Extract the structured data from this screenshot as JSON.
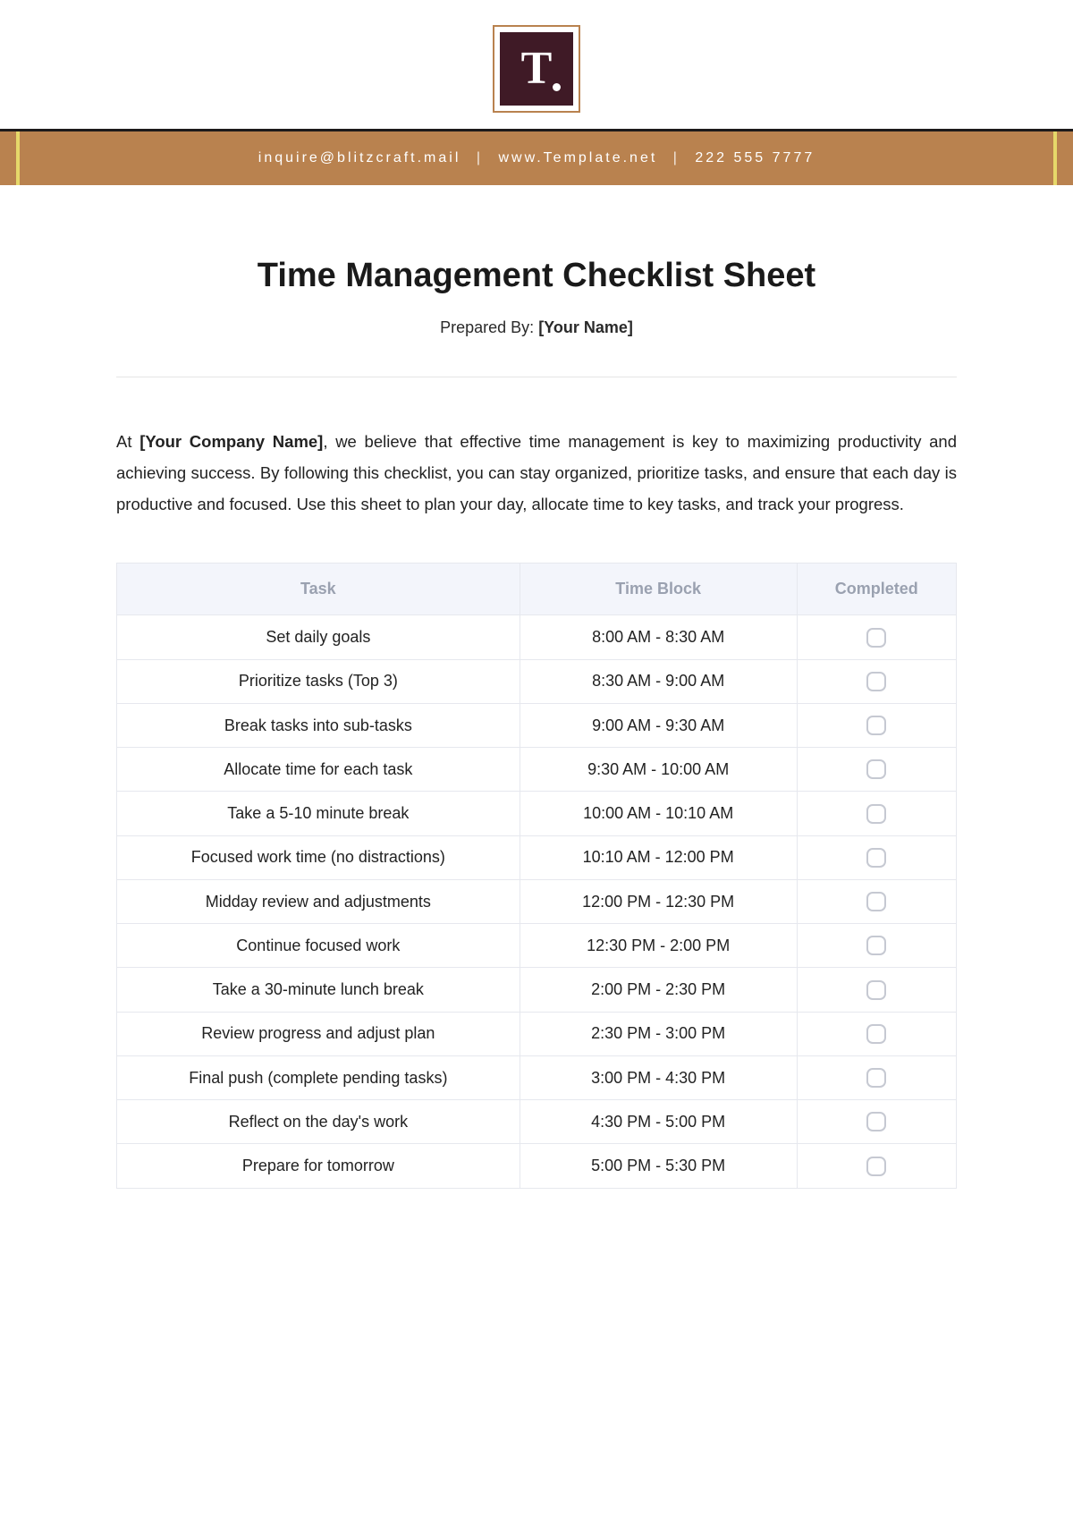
{
  "logo": {
    "letter": "T"
  },
  "banner": {
    "email": "inquire@blitzcraft.mail",
    "site": "www.Template.net",
    "phone": "222 555 7777"
  },
  "title": "Time Management Checklist Sheet",
  "prepared_by_label": "Prepared By: ",
  "prepared_by_value": "[Your Name]",
  "intro_prefix": "At ",
  "intro_company": "[Your Company Name]",
  "intro_rest": ", we believe that effective time management is key to maximizing productivity and achieving success. By following this checklist, you can stay organized, prioritize tasks, and ensure that each day is productive and focused. Use this sheet to plan your day, allocate time to key tasks, and track your progress.",
  "columns": {
    "task": "Task",
    "time": "Time Block",
    "done": "Completed"
  },
  "rows": [
    {
      "task": "Set daily goals",
      "time": "8:00 AM - 8:30 AM"
    },
    {
      "task": "Prioritize tasks (Top 3)",
      "time": "8:30 AM - 9:00 AM"
    },
    {
      "task": "Break tasks into sub-tasks",
      "time": "9:00 AM - 9:30 AM"
    },
    {
      "task": "Allocate time for each task",
      "time": "9:30 AM - 10:00 AM"
    },
    {
      "task": "Take a 5-10 minute break",
      "time": "10:00 AM - 10:10 AM"
    },
    {
      "task": "Focused work time (no distractions)",
      "time": "10:10 AM - 12:00 PM"
    },
    {
      "task": "Midday review and adjustments",
      "time": "12:00 PM - 12:30 PM"
    },
    {
      "task": "Continue focused work",
      "time": "12:30 PM - 2:00 PM"
    },
    {
      "task": "Take a 30-minute lunch break",
      "time": "2:00 PM - 2:30 PM"
    },
    {
      "task": "Review progress and adjust plan",
      "time": "2:30 PM - 3:00 PM"
    },
    {
      "task": "Final push (complete pending tasks)",
      "time": "3:00 PM - 4:30 PM"
    },
    {
      "task": "Reflect on the day's work",
      "time": "4:30 PM - 5:00 PM"
    },
    {
      "task": "Prepare for tomorrow",
      "time": "5:00 PM - 5:30 PM"
    }
  ]
}
